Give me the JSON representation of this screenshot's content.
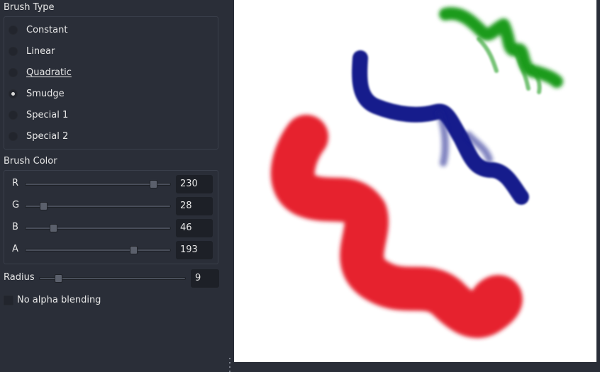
{
  "brush_type": {
    "title": "Brush Type",
    "options": [
      {
        "label": "Constant",
        "checked": false
      },
      {
        "label": "Linear",
        "checked": false
      },
      {
        "label": "Quadratic",
        "checked": false
      },
      {
        "label": "Smudge",
        "checked": true
      },
      {
        "label": "Special 1",
        "checked": false
      },
      {
        "label": "Special 2",
        "checked": false
      }
    ]
  },
  "brush_color": {
    "title": "Brush Color",
    "channels": [
      {
        "label": "R",
        "value": "230",
        "fraction": 0.902
      },
      {
        "label": "G",
        "value": "28",
        "fraction": 0.11
      },
      {
        "label": "B",
        "value": "46",
        "fraction": 0.18
      },
      {
        "label": "A",
        "value": "193",
        "fraction": 0.757
      }
    ]
  },
  "radius": {
    "label": "Radius",
    "value": "9",
    "fraction": 0.11
  },
  "alpha_blending": {
    "label": "No alpha blending",
    "checked": false
  },
  "colors": {
    "panel_bg": "#2a2e38",
    "canvas_bg": "#ffffff",
    "stroke_red": "#e6222f",
    "stroke_blue": "#141e8c",
    "stroke_green": "#1e9b1e"
  }
}
